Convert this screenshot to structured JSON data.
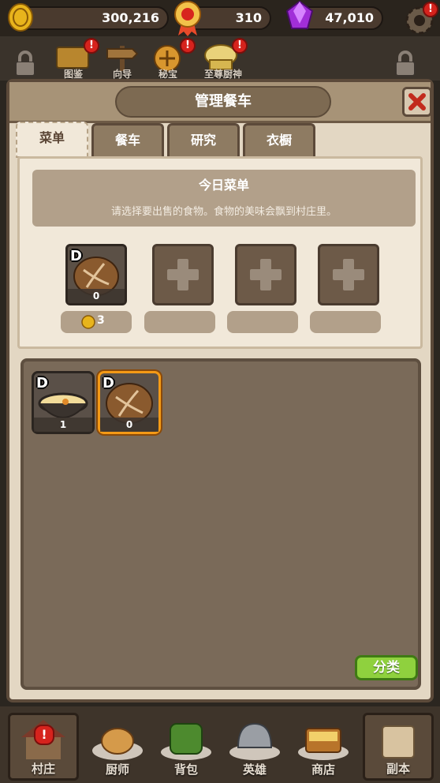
{
  "currency": {
    "gold": "300,216",
    "medal": "310",
    "gem": "47,010"
  },
  "header_strip": {
    "items": [
      {
        "label": "图鉴",
        "badge": "!"
      },
      {
        "label": "向导",
        "badge": "!"
      },
      {
        "label": "秘宝",
        "badge": "!"
      },
      {
        "label": "至尊厨神",
        "badge": "!"
      }
    ],
    "settings_badge": "!"
  },
  "panel": {
    "title": "管理餐车",
    "close_icon": "close-icon",
    "tabs": [
      {
        "label": "菜单",
        "active": true
      },
      {
        "label": "餐车",
        "active": false
      },
      {
        "label": "研究",
        "active": false
      },
      {
        "label": "衣橱",
        "active": false
      }
    ],
    "today_menu": {
      "title": "今日菜单",
      "subtitle": "请选择要出售的食物。食物的美味会飘到村庄里。"
    },
    "slots": [
      {
        "grade": "D",
        "count": "0",
        "price": "3",
        "filled": true,
        "food": "bread"
      },
      {
        "filled": false
      },
      {
        "filled": false
      },
      {
        "filled": false
      }
    ],
    "inventory": [
      {
        "grade": "D",
        "count": "1",
        "food": "soup"
      },
      {
        "grade": "D",
        "count": "0",
        "food": "bread",
        "selected": true
      }
    ],
    "sort_label": "分类"
  },
  "bottom_nav": [
    {
      "label": "村庄",
      "badge": "!"
    },
    {
      "label": "厨师"
    },
    {
      "label": "背包"
    },
    {
      "label": "英雄"
    },
    {
      "label": "商店"
    },
    {
      "label": "副本"
    }
  ],
  "colors": {
    "panel_bg": "#e3d7c3",
    "accent_orange": "#f49a16",
    "sort_green": "#8fd13e",
    "badge_red": "#d6231d"
  }
}
